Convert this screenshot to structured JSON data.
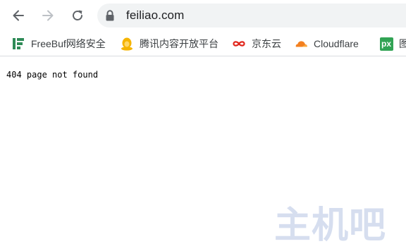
{
  "address_bar": {
    "url": "feiliao.com"
  },
  "bookmarks": [
    {
      "label": "FreeBuf网络安全",
      "icon": "freebuf-icon"
    },
    {
      "label": "腾讯内容开放平台",
      "icon": "tencent-penguin-icon"
    },
    {
      "label": "京东云",
      "icon": "jdcloud-icon"
    },
    {
      "label": "Cloudflare",
      "icon": "cloudflare-icon"
    },
    {
      "label": "图",
      "icon": "px-icon",
      "icon_text": "px"
    }
  ],
  "page": {
    "message": "404 page not found"
  },
  "watermark": {
    "text": "主机吧"
  },
  "colors": {
    "toolbar_icon": "#5f6368",
    "omnibox_bg": "#f1f3f4",
    "freebuf_green": "#2e8b57",
    "tencent_yellow": "#f5b400",
    "jd_red": "#e1251b",
    "cloudflare_orange": "#f38020",
    "px_green": "#31a354"
  }
}
